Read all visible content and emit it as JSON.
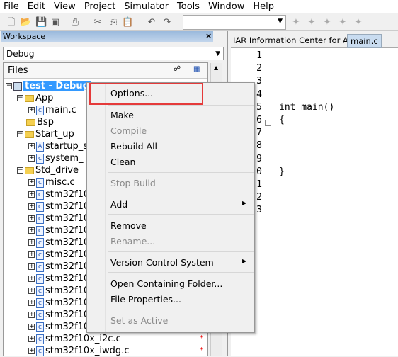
{
  "menu": [
    "File",
    "Edit",
    "View",
    "Project",
    "Simulator",
    "Tools",
    "Window",
    "Help"
  ],
  "toolbar_icons": [
    "new-file-icon",
    "open-icon",
    "save-icon",
    "save-all-icon",
    "print-icon",
    "cut-icon",
    "copy-icon",
    "paste-icon",
    "undo-icon",
    "redo-icon"
  ],
  "workspace": {
    "title": "Workspace",
    "close": "×",
    "config": "Debug",
    "files_header": "Files"
  },
  "tree": [
    {
      "label": "test - Debug",
      "level": 0,
      "type": "project",
      "selected": true
    },
    {
      "label": "App",
      "level": 1,
      "type": "folder"
    },
    {
      "label": "main.c",
      "level": 2,
      "type": "c"
    },
    {
      "label": "Bsp",
      "level": 1,
      "type": "folder"
    },
    {
      "label": "Start_up",
      "level": 1,
      "type": "folder"
    },
    {
      "label": "startup_s",
      "level": 2,
      "type": "asm"
    },
    {
      "label": "system_",
      "level": 2,
      "type": "c"
    },
    {
      "label": "Std_drive",
      "level": 1,
      "type": "folder"
    },
    {
      "label": "misc.c",
      "level": 2,
      "type": "c"
    },
    {
      "label": "stm32f10",
      "level": 2,
      "type": "c"
    },
    {
      "label": "stm32f10",
      "level": 2,
      "type": "c"
    },
    {
      "label": "stm32f10",
      "level": 2,
      "type": "c"
    },
    {
      "label": "stm32f10",
      "level": 2,
      "type": "c"
    },
    {
      "label": "stm32f10",
      "level": 2,
      "type": "c"
    },
    {
      "label": "stm32f10",
      "level": 2,
      "type": "c"
    },
    {
      "label": "stm32f10",
      "level": 2,
      "type": "c"
    },
    {
      "label": "stm32f10",
      "level": 2,
      "type": "c"
    },
    {
      "label": "stm32f10",
      "level": 2,
      "type": "c"
    },
    {
      "label": "stm32f10",
      "level": 2,
      "type": "c"
    },
    {
      "label": "stm32f10",
      "level": 2,
      "type": "c"
    },
    {
      "label": "stm32f10",
      "level": 2,
      "type": "c"
    },
    {
      "label": "stm32f10x_i2c.c",
      "level": 2,
      "type": "c",
      "mark": "*"
    },
    {
      "label": "stm32f10x_iwdg.c",
      "level": 2,
      "type": "c",
      "mark": "*"
    }
  ],
  "context_menu": [
    {
      "label": "Options...",
      "enabled": true,
      "highlighted": true
    },
    {
      "sep": true
    },
    {
      "label": "Make",
      "enabled": true
    },
    {
      "label": "Compile",
      "enabled": false
    },
    {
      "label": "Rebuild All",
      "enabled": true
    },
    {
      "label": "Clean",
      "enabled": true
    },
    {
      "sep": true
    },
    {
      "label": "Stop Build",
      "enabled": false
    },
    {
      "sep": true
    },
    {
      "label": "Add",
      "enabled": true,
      "submenu": true
    },
    {
      "sep": true
    },
    {
      "label": "Remove",
      "enabled": true
    },
    {
      "label": "Rename...",
      "enabled": false
    },
    {
      "sep": true
    },
    {
      "label": "Version Control System",
      "enabled": true,
      "submenu": true
    },
    {
      "sep": true
    },
    {
      "label": "Open Containing Folder...",
      "enabled": true
    },
    {
      "label": "File Properties...",
      "enabled": true
    },
    {
      "sep": true
    },
    {
      "label": "Set as Active",
      "enabled": false
    }
  ],
  "editor": {
    "tabs": [
      "IAR Information Center for ARM",
      "main.c"
    ],
    "active_tab": 1,
    "line_numbers": [
      "1",
      "2",
      "3",
      "4",
      "5",
      "6",
      "7",
      "8",
      "9",
      "0",
      "1",
      "2",
      "3"
    ],
    "code": {
      "4": "int main()",
      "5": "{",
      "9": "}"
    }
  },
  "colors": {
    "selection": "#3399ff",
    "highlight_box": "#e53a3a"
  }
}
